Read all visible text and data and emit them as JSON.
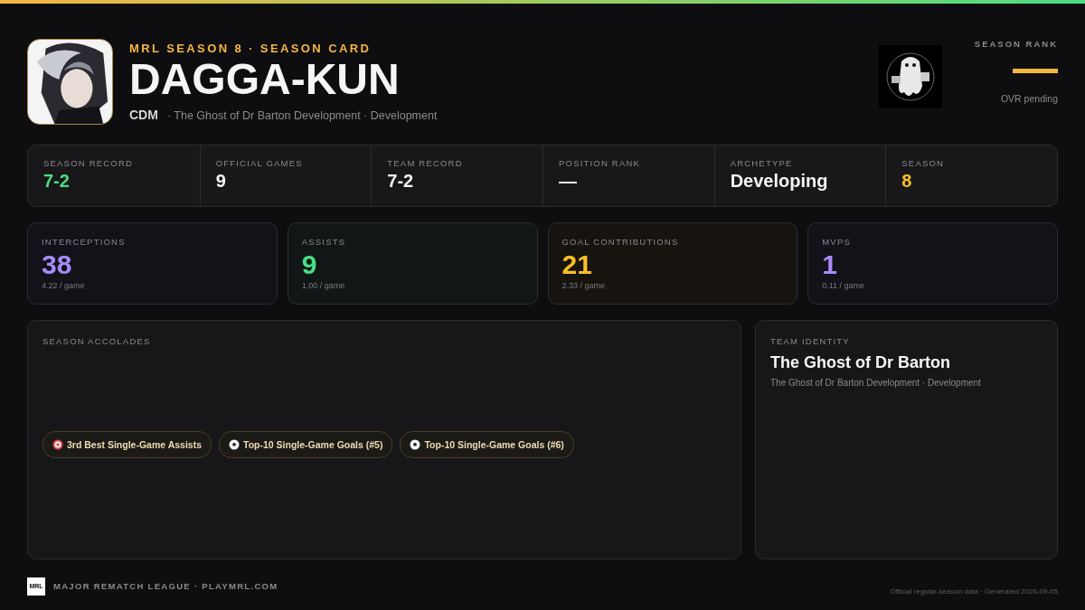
{
  "header": {
    "eyebrow": "MRL SEASON 8 · SEASON CARD",
    "name": "DAGGA-KUN",
    "position": "CDM",
    "team_line": "· The Ghost of Dr Barton Development · Development",
    "rank_label": "SEASON RANK",
    "rank_note": "OVR pending"
  },
  "summary": [
    {
      "label": "SEASON RECORD",
      "value": "7-2",
      "color": "#4ade80"
    },
    {
      "label": "OFFICIAL GAMES",
      "value": "9",
      "color": "#f5f5f5"
    },
    {
      "label": "TEAM RECORD",
      "value": "7-2",
      "color": "#f5f5f5"
    },
    {
      "label": "POSITION RANK",
      "value": "—",
      "color": "#f5f5f5"
    },
    {
      "label": "ARCHETYPE",
      "value": "Developing",
      "color": "#f5f5f5"
    },
    {
      "label": "SEASON",
      "value": "8",
      "color": "#fbbf24"
    }
  ],
  "tiles": [
    {
      "label": "INTERCEPTIONS",
      "value": "38",
      "rate": "4.22 / game",
      "color": "#a78bfa"
    },
    {
      "label": "ASSISTS",
      "value": "9",
      "rate": "1.00 / game",
      "color": "#4ade80"
    },
    {
      "label": "GOAL CONTRIBUTIONS",
      "value": "21",
      "rate": "2.33 / game",
      "color": "#fbbf24"
    },
    {
      "label": "MVPS",
      "value": "1",
      "rate": "0.11 / game",
      "color": "#a78bfa"
    }
  ],
  "accolades": {
    "title": "SEASON ACCOLADES",
    "items": [
      {
        "kind": "target",
        "label": "3rd Best Single-Game Assists"
      },
      {
        "kind": "ball",
        "label": "Top-10 Single-Game Goals (#5)"
      },
      {
        "kind": "ball",
        "label": "Top-10 Single-Game Goals (#6)"
      }
    ]
  },
  "team": {
    "title": "TEAM IDENTITY",
    "name": "The Ghost of Dr Barton",
    "subtitle": "The Ghost of Dr Barton Development · Development"
  },
  "footer": {
    "logo": "MRL",
    "league": "MAJOR REMATCH LEAGUE · PLAYMRL.COM",
    "note": "Official regular-season data · Generated 2026-09-05"
  }
}
